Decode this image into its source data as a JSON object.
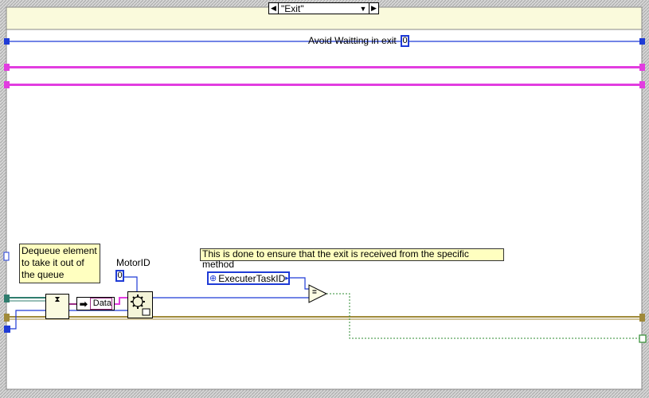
{
  "case_selector": {
    "decrement_glyph": "◀",
    "increment_glyph": "▶",
    "value": "\"Exit\"",
    "dropdown_glyph": "▼"
  },
  "top_control": {
    "label": "Avoid Waitting in exit",
    "value": "0"
  },
  "comments": {
    "dequeue": [
      "Dequeue element",
      "to take it out of",
      "the queue"
    ],
    "exit_note": "This is done to ensure that the exit is received from the specific method"
  },
  "motor": {
    "label": "MotorID",
    "value": "0"
  },
  "unbundle": {
    "arrow": "➡",
    "field": "Data"
  },
  "ring_constant": {
    "glyph": "⊕",
    "value": "ExecuterTaskID",
    "arrow": "▸"
  },
  "compare": {
    "symbol": "="
  },
  "dequeue_icon": {
    "glyph": "⧗"
  },
  "colors": {
    "frame_fill": "#d4d4d4",
    "header_fill": "#fafadc",
    "wire_blue": "#1f3bd6",
    "wire_pink": "#e23de0",
    "wire_teal": "#2f7d6e",
    "wire_olive": "#a08a3a",
    "wire_green": "#2e8b30"
  }
}
